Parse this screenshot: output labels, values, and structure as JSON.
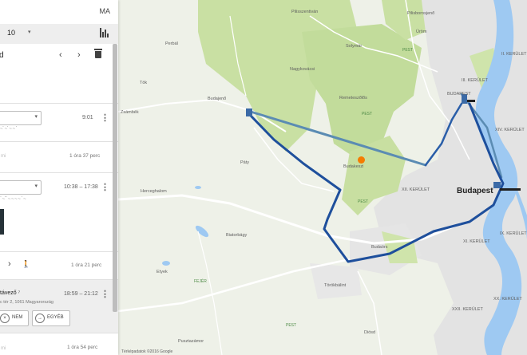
{
  "header": {
    "account_initials": "MA",
    "day_value": "10",
    "day_caret": "▾",
    "stats_icon": "bar-chart-icon"
  },
  "title_row": {
    "title": "d",
    "prev": "‹",
    "next": "›",
    "delete_icon": "trash-icon"
  },
  "timeline": [
    {
      "type": "place",
      "time": "9:01",
      "value_caret": "▾",
      "scribble": "~ˋ ~ˋ ~ ~ ˋ",
      "kebab": "⋮"
    },
    {
      "type": "move",
      "faint": "mi",
      "duration": "1 óra 37 perc"
    },
    {
      "type": "place",
      "time": "10:38 – 17:38",
      "value_caret": "▾",
      "scribble": "ˋ ~ˋˋ ~ ~ ~ ~ ˋ ~",
      "kebab": "⋮"
    },
    {
      "type": "move",
      "chevron": "›",
      "walk_icon": "🚶",
      "duration": "1 óra 21 perc"
    },
    {
      "type": "place_question",
      "name": "távező",
      "name_icon": "⁷",
      "time": "18:59 – 21:12",
      "address": "c tér 2, 1061 Magyarország",
      "kebab": "⋮",
      "buttons": [
        {
          "label": "NEM",
          "icon": "×"
        },
        {
          "label": "EGYÉB",
          "icon": "→"
        }
      ]
    },
    {
      "type": "move",
      "faint": "mi",
      "duration": "1 óra 54 perc"
    }
  ],
  "map": {
    "attribution": "Térképadatok ©2016 Google",
    "colors": {
      "route_dark": "#1e4f9c",
      "route_light": "#5b8cb3",
      "water": "#9ec9f2",
      "forest": "#c8dea1",
      "urban": "#e6e6e6",
      "road": "#ffffff"
    },
    "labels": {
      "pilisszentivan": "Pilisszentiván",
      "solymar": "Solymár",
      "nagykovacsi": "Nagykovácsi",
      "pilisborosjeno": "Pilisborosjenő",
      "urom": "Üröm",
      "budajeno": "Budajenő",
      "perbal": "Perbál",
      "remeteszolos": "Remeteszőlős",
      "tok": "Tök",
      "zsambek": "Zsámbék",
      "budakeszi": "Budakeszi",
      "paty": "Páty",
      "herceghalom": "Herceghalom",
      "biatorbagy": "Biatorbágy",
      "budapest": "Budapest",
      "budaors": "Budaörs",
      "torokbalint": "Törökbálint",
      "etyek": "Etyek",
      "diosd": "Diósd",
      "pusztazamor": "Pusztazámor",
      "kerulet_ii": "II. KERÜLET",
      "kerulet_iii": "III. KERÜLET",
      "kerulet_xiv": "XIV. KERÜLET",
      "kerulet_xii": "XII. KERÜLET",
      "kerulet_xi": "XI. KERÜLET",
      "kerulet_xxii": "XXII. KERÜLET",
      "kerulet_xx": "XX. KERÜLET",
      "kerulet_ix": "IX. KERÜLET",
      "pest_1": "PEST",
      "pest_2": "PEST",
      "pest_3": "PEST",
      "pest_4": "PEST",
      "budapest_lower": "BUDAPEST",
      "fejer": "FEJÉR"
    }
  }
}
